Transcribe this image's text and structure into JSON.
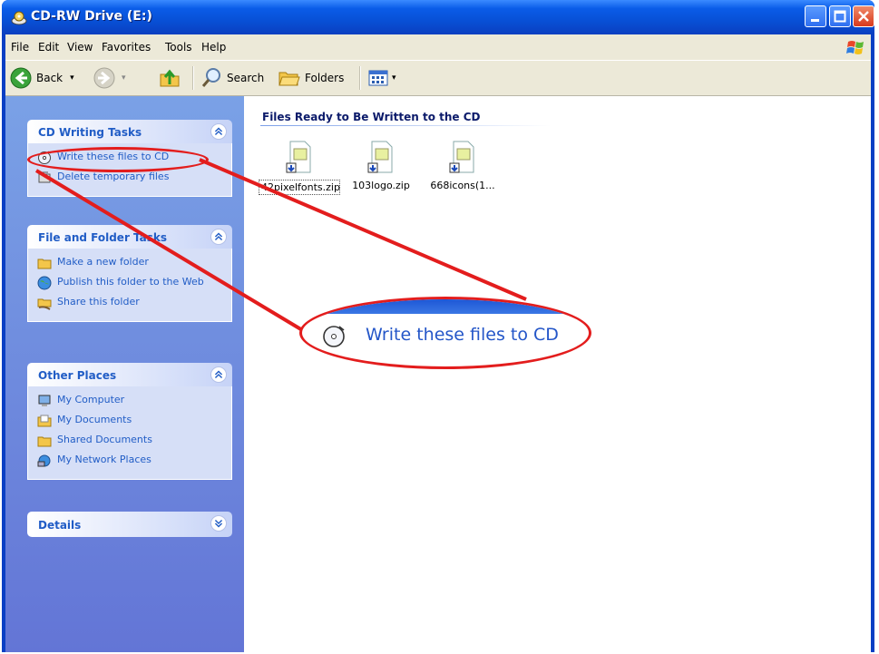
{
  "window": {
    "title": "CD-RW Drive (E:)"
  },
  "menu": [
    "File",
    "Edit",
    "View",
    "Favorites",
    "Tools",
    "Help"
  ],
  "toolbar": {
    "back": "Back",
    "search": "Search",
    "folders": "Folders"
  },
  "panels": {
    "cd_tasks": {
      "title": "CD Writing Tasks",
      "items": [
        "Write these files to CD",
        "Delete temporary files"
      ]
    },
    "file_folder": {
      "title": "File and Folder Tasks",
      "items": [
        "Make a new folder",
        "Publish this folder to the Web",
        "Share this folder"
      ]
    },
    "other_places": {
      "title": "Other Places",
      "items": [
        "My Computer",
        "My Documents",
        "Shared Documents",
        "My Network Places"
      ]
    },
    "details": {
      "title": "Details"
    }
  },
  "main": {
    "group_title": "Files Ready to Be Written to the CD",
    "files": [
      "42pixelfonts.zip",
      "103logo.zip",
      "668icons(1..."
    ]
  },
  "callout": {
    "label": "Write these files to CD"
  },
  "colors": {
    "titlebar": "#0a5ce8",
    "annotation": "#e31d1d",
    "link": "#215dc6",
    "taskpane": "#6f8ddc"
  }
}
